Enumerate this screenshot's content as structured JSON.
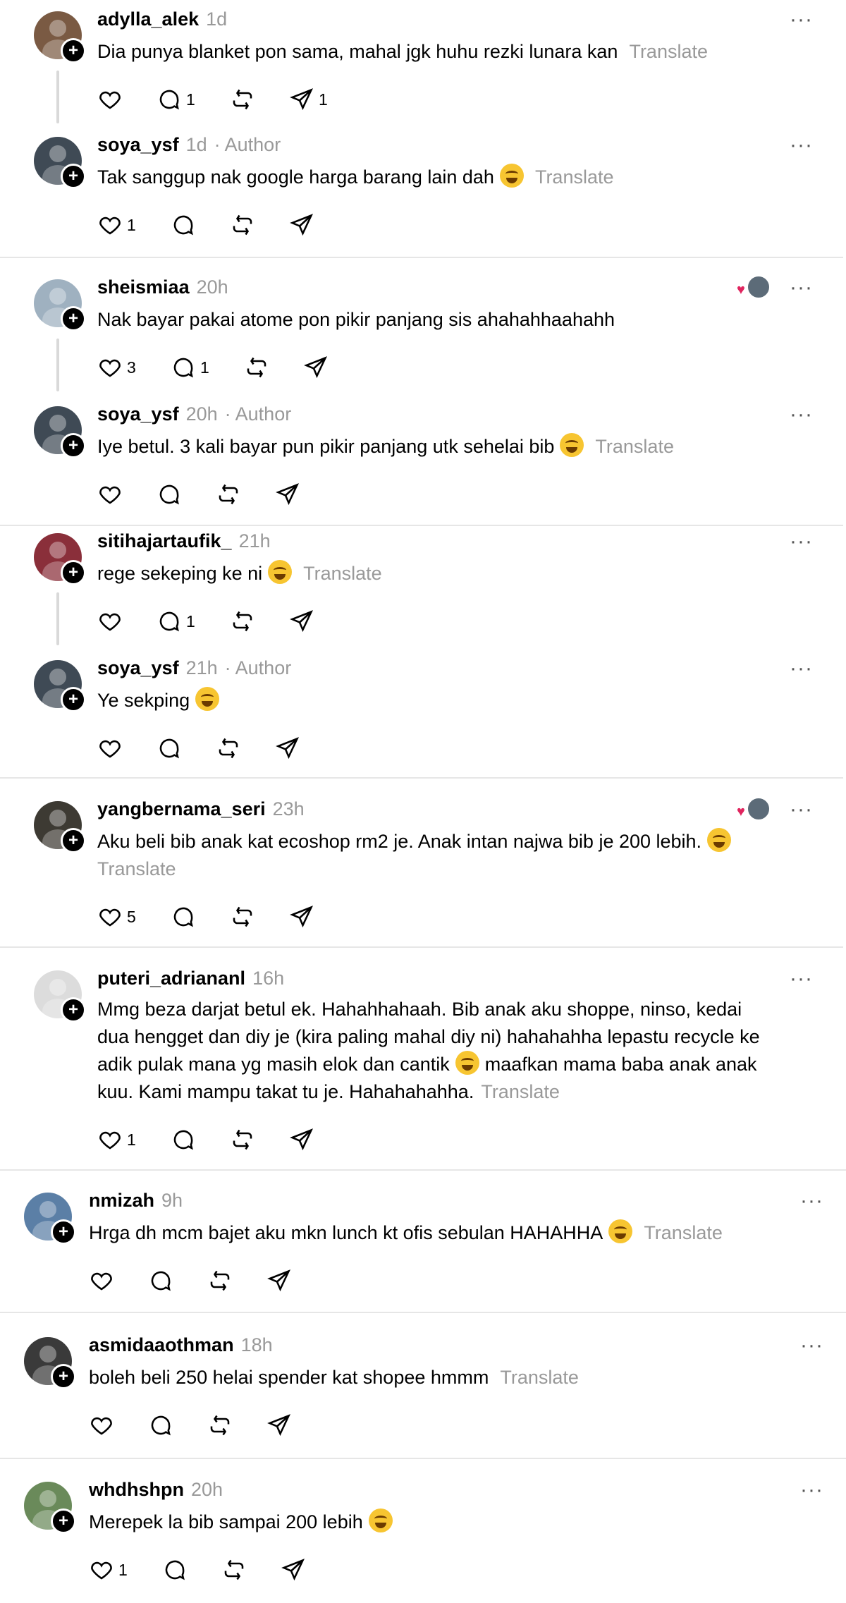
{
  "posts": [
    {
      "username": "adylla_alek",
      "time": "1d",
      "author": "",
      "text": "Dia punya blanket pon sama, mahal jgk huhu rezki lunara kan",
      "emoji": false,
      "translate": "Translate",
      "likes": "",
      "replies": "1",
      "reposts": "",
      "shares": "1",
      "avatar_color": "#7a5a43",
      "avatar_icon": "avatar-icon"
    },
    {
      "username": "soya_ysf",
      "time": "1d",
      "author": "· Author",
      "text": "Tak sanggup nak google harga barang lain dah",
      "emoji": true,
      "translate": "Translate",
      "likes": "1",
      "replies": "",
      "reposts": "",
      "shares": "",
      "avatar_color": "#3f4a55",
      "avatar_icon": "avatar-icon"
    },
    {
      "username": "sheismiaa",
      "time": "20h",
      "author": "",
      "text": "Nak bayar pakai atome pon pikir panjang sis ahahahhaahahh",
      "emoji": false,
      "translate": "",
      "likes": "3",
      "replies": "1",
      "reposts": "",
      "shares": "",
      "avatar_color": "#9fb1c0",
      "avatar_icon": "avatar-icon"
    },
    {
      "username": "soya_ysf",
      "time": "20h",
      "author": "· Author",
      "text": "Iye betul. 3 kali bayar pun pikir panjang utk sehelai bib",
      "emoji": true,
      "translate": "Translate",
      "likes": "",
      "replies": "",
      "reposts": "",
      "shares": "",
      "avatar_color": "#3f4a55",
      "avatar_icon": "avatar-icon"
    },
    {
      "username": "sitihajartaufik_",
      "time": "21h",
      "author": "",
      "text": "rege sekeping ke ni",
      "emoji": true,
      "translate": "Translate",
      "likes": "",
      "replies": "1",
      "reposts": "",
      "shares": "",
      "avatar_color": "#8a2f3a",
      "avatar_icon": "avatar-icon"
    },
    {
      "username": "soya_ysf",
      "time": "21h",
      "author": "· Author",
      "text": "Ye sekping",
      "emoji": true,
      "translate": "",
      "likes": "",
      "replies": "",
      "reposts": "",
      "shares": "",
      "avatar_color": "#3f4a55",
      "avatar_icon": "avatar-icon"
    },
    {
      "username": "yangbernama_seri",
      "time": "23h",
      "author": "",
      "text": "Aku beli bib anak kat ecoshop rm2 je. Anak intan najwa bib je 200 lebih.",
      "text2": "",
      "emoji": true,
      "translate": "Translate",
      "likes": "5",
      "replies": "",
      "reposts": "",
      "shares": "",
      "avatar_color": "#3d3a33",
      "avatar_icon": "avatar-icon"
    },
    {
      "username": "puteri_adriananl",
      "time": "16h",
      "author": "",
      "lines": [
        "Mmg beza darjat betul ek. Hahahhahaah. Bib anak aku shoppe, ninso, kedai",
        "dua hengget dan diy je (kira paling mahal diy ni) hahahahha lepastu recycle ke",
        "adik pulak mana yg masih elok dan cantik",
        "kuu. Kami mampu takat tu je. Hahahahahha."
      ],
      "line3_rest": "maafkan mama baba anak anak",
      "translate": "Translate",
      "likes": "1",
      "replies": "",
      "reposts": "",
      "shares": "",
      "avatar_color": "#dcdcdc",
      "avatar_icon": "avatar-icon"
    },
    {
      "username": "nmizah",
      "time": "9h",
      "author": "",
      "text": "Hrga dh mcm bajet aku mkn lunch kt ofis sebulan HAHAHHA",
      "emoji": true,
      "translate": "Translate",
      "likes": "",
      "replies": "",
      "reposts": "",
      "shares": "",
      "avatar_color": "#5b7fa6",
      "avatar_icon": "avatar-icon"
    },
    {
      "username": "asmidaaothman",
      "time": "18h",
      "author": "",
      "text": "boleh beli 250 helai spender kat shopee hmmm",
      "emoji": false,
      "translate": "Translate",
      "likes": "",
      "replies": "",
      "reposts": "",
      "shares": "",
      "avatar_color": "#3a3a3a",
      "avatar_icon": "avatar-icon"
    },
    {
      "username": "whdhshpn",
      "time": "20h",
      "author": "",
      "text": "Merepek la bib sampai 200 lebih",
      "emoji": true,
      "translate": "",
      "likes": "1",
      "replies": "",
      "reposts": "",
      "shares": "",
      "avatar_color": "#6a8a5a",
      "avatar_icon": "avatar-icon"
    }
  ],
  "icons": {
    "more": "more-icon",
    "like": "heart-icon",
    "reply": "comment-icon",
    "repost": "repost-icon",
    "share": "share-icon",
    "follow": "plus-icon"
  },
  "more_glyph": "···",
  "plus_glyph": "+",
  "heart_glyph": "♥"
}
